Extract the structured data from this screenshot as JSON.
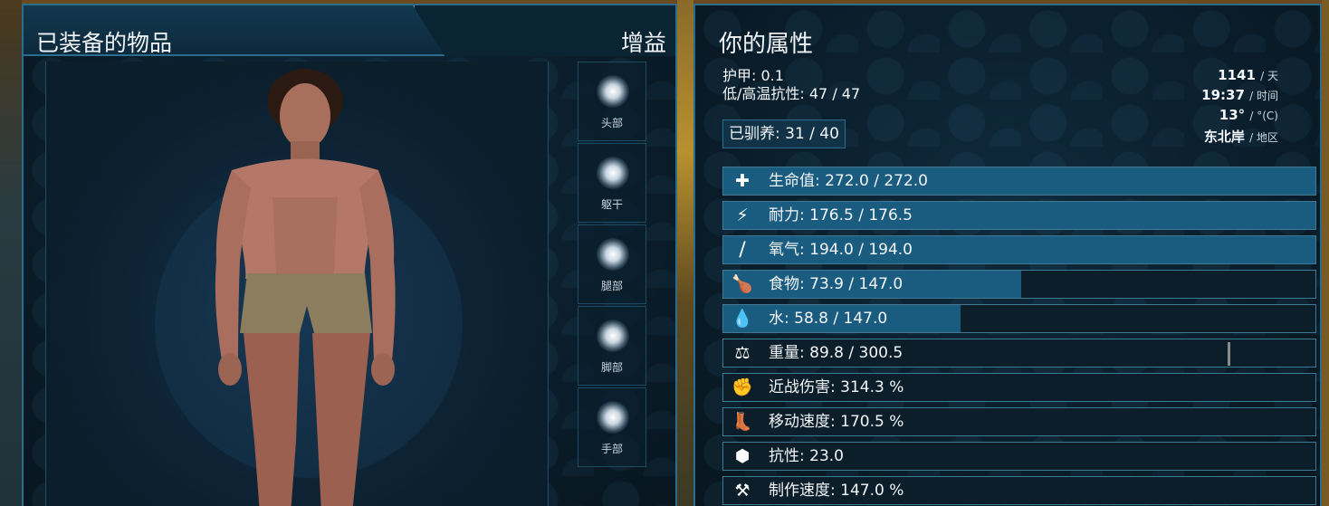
{
  "equipment_panel": {
    "title": "已装备的物品",
    "buff_label": "增益",
    "slots": [
      {
        "label": "头部"
      },
      {
        "label": "躯干"
      },
      {
        "label": "腿部"
      },
      {
        "label": "脚部"
      },
      {
        "label": "手部"
      }
    ]
  },
  "attributes_panel": {
    "title": "你的属性",
    "armor": "护甲: 0.1",
    "temp_resist": "低/高温抗性: 47 / 47",
    "tamed": "已驯养: 31 / 40",
    "info": {
      "day_value": "1141",
      "day_unit": "/ 天",
      "time_value": "19:37",
      "time_unit": "/ 时间",
      "temp_value": "13°",
      "temp_unit": "/ °(C)",
      "region_value": "东北岸",
      "region_unit": "/ 地区"
    },
    "stats": [
      {
        "icon": "health-cross-icon",
        "glyph": "✚",
        "label": "生命值: 272.0 / 272.0",
        "fraction": 1.0
      },
      {
        "icon": "stamina-bolt-icon",
        "glyph": "⚡",
        "label": "耐力: 176.5 / 176.5",
        "fraction": 1.0
      },
      {
        "icon": "oxygen-tank-icon",
        "glyph": "⧸",
        "label": "氧气: 194.0 / 194.0",
        "fraction": 1.0
      },
      {
        "icon": "food-drumstick-icon",
        "glyph": "🍗",
        "label": "食物: 73.9 / 147.0",
        "fraction": 0.503
      },
      {
        "icon": "water-drop-icon",
        "glyph": "💧",
        "label": "水: 58.8 / 147.0",
        "fraction": 0.4
      },
      {
        "icon": "weight-icon",
        "glyph": "⚖",
        "label": "重量: 89.8 / 300.5",
        "fraction": 0.0,
        "marker": 0.851
      },
      {
        "icon": "melee-fist-icon",
        "glyph": "✊",
        "label": "近战伤害: 314.3 %",
        "fraction": 0.0
      },
      {
        "icon": "movement-boot-icon",
        "glyph": "👢",
        "label": "移动速度: 170.5 %",
        "fraction": 0.0
      },
      {
        "icon": "fortitude-icon",
        "glyph": "⬢",
        "label": "抗性: 23.0",
        "fraction": 0.0
      },
      {
        "icon": "crafting-tools-icon",
        "glyph": "⚒",
        "label": "制作速度: 147.0 %",
        "fraction": 0.0
      }
    ]
  }
}
